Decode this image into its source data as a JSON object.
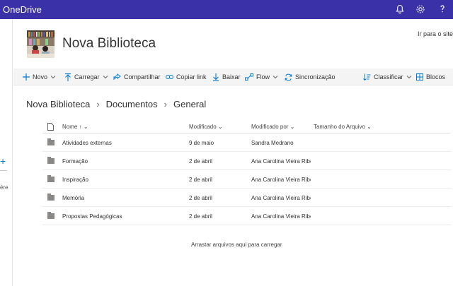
{
  "app": {
    "name": "OneDrive"
  },
  "site": {
    "title": "Nova Biblioteca",
    "goto": "Ir para o site"
  },
  "commands": {
    "new": "Novo",
    "upload": "Carregar",
    "share": "Compartilhar",
    "copy_link": "Copiar link",
    "download": "Baixar",
    "flow": "Flow",
    "sync": "Sincronização",
    "sort": "Classificar",
    "view": "Blocos"
  },
  "breadcrumb": [
    "Nova Biblioteca",
    "Documentos",
    "General"
  ],
  "columns": {
    "name": "Nome",
    "sort_arrow": "↑",
    "modified": "Modificado",
    "modified_by": "Modificado por",
    "size": "Tamanho do Arquivo"
  },
  "rows": [
    {
      "name": "Atividades externas",
      "modified": "9 de maio",
      "by": "Sandra Medrano"
    },
    {
      "name": "Formação",
      "modified": "2 de abril",
      "by": "Ana Carolina Vieira Ribeiro"
    },
    {
      "name": "Inspiração",
      "modified": "2 de abril",
      "by": "Ana Carolina Vieira Ribeiro"
    },
    {
      "name": "Memória",
      "modified": "2 de abril",
      "by": "Ana Carolina Vieira Ribeiro"
    },
    {
      "name": "Propostas Pedagógicas",
      "modified": "2 de abril",
      "by": "Ana Carolina Vieira Ribeiro"
    }
  ],
  "drop_hint": "Arrastar arquivos aqui para carregar",
  "left_rail": {
    "plus": "+",
    "text": "ére"
  },
  "colors": {
    "topbar": "#3a31a8",
    "accent": "#0078d4"
  }
}
